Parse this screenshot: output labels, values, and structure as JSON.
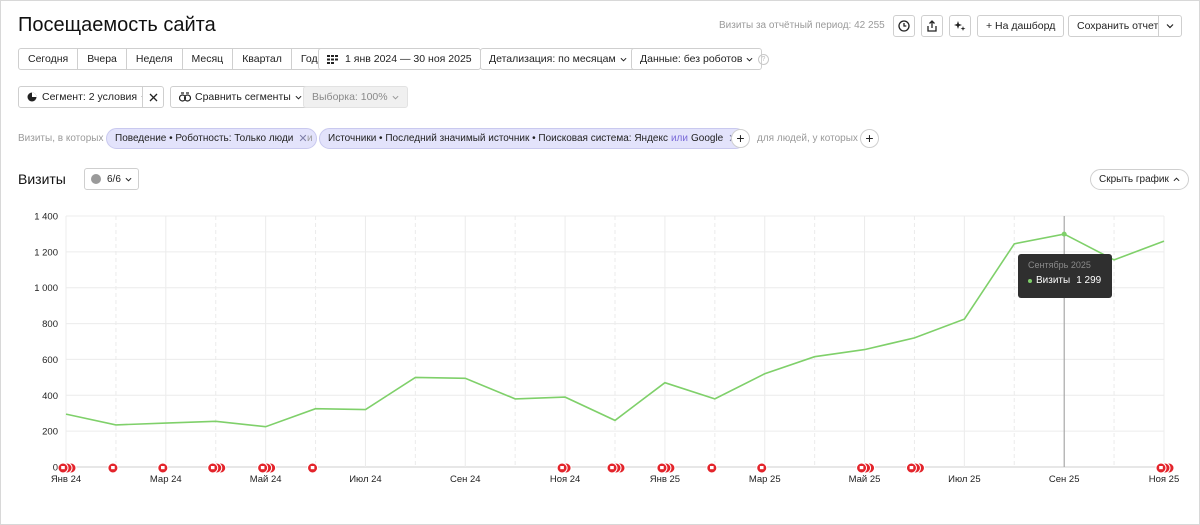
{
  "header": {
    "title": "Посещаемость сайта",
    "visits_period": "Визиты за отчётный период: 42 255",
    "dashboard_label": "+ На дашборд",
    "save_report_label": "Сохранить отчет"
  },
  "period_tabs": [
    "Сегодня",
    "Вчера",
    "Неделя",
    "Месяц",
    "Квартал",
    "Год"
  ],
  "controls": {
    "date_range": "1 янв 2024 — 30 ноя 2025",
    "detail": "Детализация: по месяцам",
    "data": "Данные: без роботов",
    "segment": "Сегмент: 2 условия",
    "compare": "Сравнить сегменты",
    "sample": "Выборка: 100%"
  },
  "filters": {
    "prefix": "Визиты, в которых",
    "chip1": "Поведение • Роботность: Только люди",
    "and": "и",
    "chip2_part1": "Источники • Последний значимый источник • Поисковая система: Яндекс",
    "chip2_or": "или",
    "chip2_part2": "Google",
    "people_label": "для людей, у которых"
  },
  "chart_section": {
    "title": "Визиты",
    "series_count": "6/6",
    "hide_chart": "Скрыть график"
  },
  "tooltip": {
    "title": "Сентябрь 2025",
    "series": "Визиты",
    "value": "1 299"
  },
  "colors": {
    "line": "#7fd06a",
    "annotation": "#e3242b",
    "chip_bg": "#e3e3fb"
  },
  "chart_data": {
    "type": "line",
    "x": [
      "Янв 24",
      "Фев 24",
      "Мар 24",
      "Апр 24",
      "Май 24",
      "Июн 24",
      "Июл 24",
      "Авг 24",
      "Сен 24",
      "Окт 24",
      "Ноя 24",
      "Дек 24",
      "Янв 25",
      "Фев 25",
      "Мар 25",
      "Апр 25",
      "Май 25",
      "Июн 25",
      "Июл 25",
      "Авг 25",
      "Сен 25",
      "Окт 25",
      "Ноя 25"
    ],
    "series": [
      {
        "name": "Визиты",
        "values": [
          295,
          235,
          245,
          255,
          225,
          325,
          320,
          500,
          495,
          380,
          390,
          260,
          470,
          380,
          520,
          615,
          655,
          720,
          825,
          1245,
          1299,
          1155,
          1260
        ]
      }
    ],
    "x_tick_labels": [
      "Янв 24",
      "Мар 24",
      "Май 24",
      "Июл 24",
      "Сен 24",
      "Ноя 24",
      "Янв 25",
      "Мар 25",
      "Май 25",
      "Июл 25",
      "Сен 25",
      "Ноя 25"
    ],
    "y_tick_labels": [
      "0",
      "200",
      "400",
      "600",
      "800",
      "1 000",
      "1 200",
      "1 400"
    ],
    "ylim": [
      0,
      1400
    ],
    "grid": true,
    "annotations": [
      {
        "x": "Янв 24",
        "count": 3
      },
      {
        "x": "Фев 24",
        "count": 1
      },
      {
        "x": "Мар 24",
        "count": 1
      },
      {
        "x": "Апр 24",
        "count": 3
      },
      {
        "x": "Май 24",
        "count": 3
      },
      {
        "x": "Июн 24",
        "count": 1
      },
      {
        "x": "Ноя 24",
        "count": 2
      },
      {
        "x": "Дек 24",
        "count": 3
      },
      {
        "x": "Янв 25",
        "count": 3
      },
      {
        "x": "Фев 25",
        "count": 1
      },
      {
        "x": "Мар 25",
        "count": 1
      },
      {
        "x": "Май 25",
        "count": 3
      },
      {
        "x": "Июн 25",
        "count": 3
      },
      {
        "x": "Ноя 25",
        "count": 3
      }
    ],
    "highlight": "Сен 25"
  }
}
